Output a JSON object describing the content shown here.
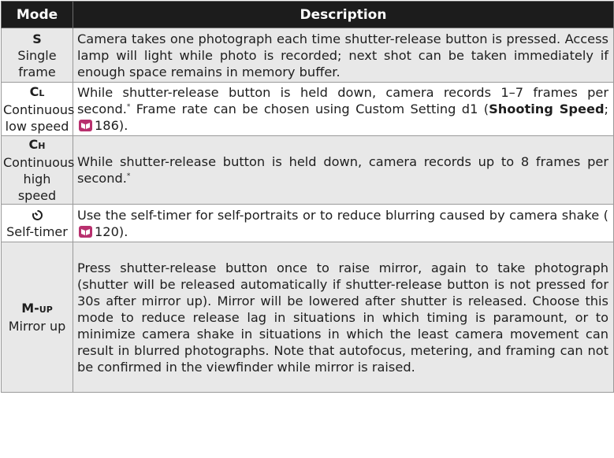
{
  "header": {
    "mode": "Mode",
    "description": "Description"
  },
  "rows": [
    {
      "symbol": "S",
      "symbol_suffix": "",
      "name_line1": "Single",
      "name_line2": "frame",
      "description": "Camera takes one photograph each time shutter-release button is pressed.  Access lamp will light while photo is recorded; next shot can be taken immediately if enough space remains in memory buffer."
    },
    {
      "symbol": "C",
      "symbol_suffix": "L",
      "name_line1": "Continuous",
      "name_line2": "low speed",
      "desc_a": "While shutter-release button is held down, camera records 1–7 frames per second.",
      "desc_star": "*",
      "desc_b": "  Frame rate can be chosen using Custom Setting d1 (",
      "desc_term": "Shooting Speed",
      "desc_c": "; ",
      "desc_page": "186",
      "desc_d": ")."
    },
    {
      "symbol": "C",
      "symbol_suffix": "H",
      "name_line1": "Continuous",
      "name_line2": "high speed",
      "desc_a": "While shutter-release button is held down, camera records up to 8 frames per second.",
      "desc_star": "*"
    },
    {
      "symbol": "self-timer-icon",
      "name_line1": "Self-timer",
      "desc_a": "Use the self-timer for self-portraits or to reduce blurring caused by camera shake (",
      "desc_page": "120",
      "desc_d": ")."
    },
    {
      "symbol": "M-",
      "symbol_suffix": "UP",
      "name_line1": "Mirror up",
      "description": "Press shutter-release button once to raise mirror, again to take photograph (shutter will be released automatically if shutter-release button is not pressed for 30s after mirror up).  Mirror will be lowered after shutter is released.  Choose this mode to reduce release lag in situations in which timing is paramount, or to minimize camera shake in situations in which the least camera movement can result in blurred photographs.  Note that autofocus, metering, and framing can not be confirmed in the viewfinder while mirror is raised."
    }
  ],
  "icons": {
    "page_reference": "page-reference-icon",
    "self_timer": "self-timer-icon"
  },
  "colors": {
    "header_bg": "#1c1c1c",
    "row_shaded": "#e8e8e8",
    "icon_bg": "#b8306e"
  }
}
